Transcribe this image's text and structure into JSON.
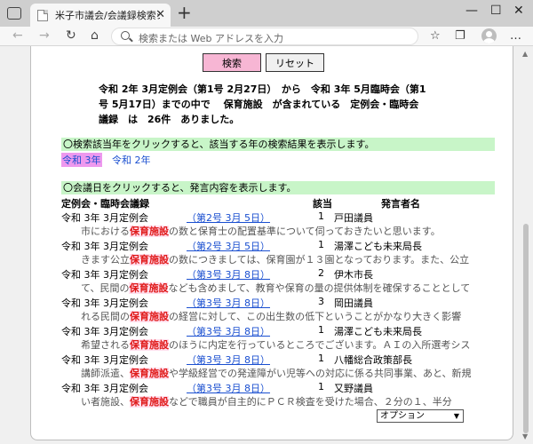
{
  "browser": {
    "tab_title": "米子市議会/会議録検索システム",
    "address_placeholder": "検索または Web アドレスを入力"
  },
  "buttons": {
    "search_label": "検索",
    "reset_label": "リセット"
  },
  "summary": {
    "line1": "令和 2年 3月定例会（第1号 2月27日）　から　令和 3年 5月臨時会（第1",
    "line2": "号 5月17日）までの中で　 保育施設　が含まれている　定例会・臨時会",
    "line3": "議録　は　26件　ありました。"
  },
  "year_section": {
    "instruction": "〇検索該当年をクリックすると、該当する年の検索結果を表示します。",
    "years": [
      {
        "label": "令和 3年",
        "active": true
      },
      {
        "label": "令和 2年",
        "active": false
      }
    ]
  },
  "results_section": {
    "instruction": "〇会議日をクリックすると、発言内容を表示します。",
    "headers": {
      "meeting": "定例会・臨時会議録",
      "count": "該当",
      "speaker": "発言者名"
    },
    "rows": [
      {
        "meeting": "令和 3年 3月定例会",
        "date": "（第2号 3月 5日）",
        "count": "1",
        "speaker": "戸田議員",
        "snippet_before": "市における",
        "snippet_term": "保育施設",
        "snippet_after": "の数と保育士の配置基準について伺っておきたいと思います。"
      },
      {
        "meeting": "令和 3年 3月定例会",
        "date": "（第2号 3月 5日）",
        "count": "1",
        "speaker": "湯澤こども未来局長",
        "snippet_before": "きます公立",
        "snippet_term": "保育施設",
        "snippet_after": "の数につきましては、保育園が１３園となっております。また、公立"
      },
      {
        "meeting": "令和 3年 3月定例会",
        "date": "（第3号 3月 8日）",
        "count": "2",
        "speaker": "伊木市長",
        "snippet_before": "て、民間の",
        "snippet_term": "保育施設",
        "snippet_after": "なども含めまして、教育や保育の量の提供体制を確保することとして"
      },
      {
        "meeting": "令和 3年 3月定例会",
        "date": "（第3号 3月 8日）",
        "count": "3",
        "speaker": "岡田議員",
        "snippet_before": "れる民間の",
        "snippet_term": "保育施設",
        "snippet_after": "の経営に対して、この出生数の低下ということがかなり大きく影響"
      },
      {
        "meeting": "令和 3年 3月定例会",
        "date": "（第3号 3月 8日）",
        "count": "1",
        "speaker": "湯澤こども未来局長",
        "snippet_before": "希望される",
        "snippet_term": "保育施設",
        "snippet_after": "のほうに内定を行っているところでございます。ＡＩの入所選考シス"
      },
      {
        "meeting": "令和 3年 3月定例会",
        "date": "（第3号 3月 8日）",
        "count": "1",
        "speaker": "八幡総合政策部長",
        "snippet_before": "講師派遣、",
        "snippet_term": "保育施設",
        "snippet_after": "や学級経営での発達障がい児等への対応に係る共同事業、あと、新規"
      },
      {
        "meeting": "令和 3年 3月定例会",
        "date": "（第3号 3月 8日）",
        "count": "1",
        "speaker": "又野議員",
        "snippet_before": "い者施設、",
        "snippet_term": "保育施設",
        "snippet_after": "などで職員が自主的にＰＣＲ検査を受けた場合、２分の１、半分"
      }
    ]
  },
  "option_select": {
    "selected": "オプション"
  }
}
